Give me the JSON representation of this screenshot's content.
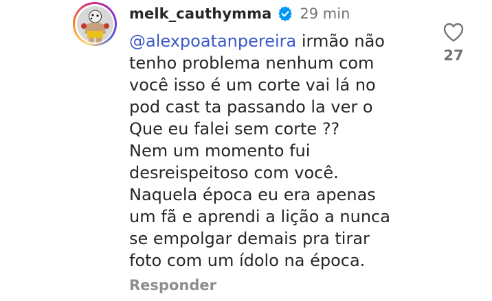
{
  "comment": {
    "username": "melk_cauthymma",
    "verified_icon": "verified-badge-icon",
    "timestamp": "29 min",
    "mention": "@alexpoatanpereira",
    "lines": [
      " irmão não",
      "tenho problema nenhum com",
      "você isso é um corte vai lá no",
      "pod cast ta passando la ver o",
      "Que eu falei sem corte ??",
      "Nem um momento fui",
      "desreispeitoso com você.",
      "Naquela época eu era apenas",
      "um fã e aprendi a lição a nunca",
      "se empolgar demais pra tirar",
      "foto com um ídolo na época."
    ],
    "reply_label": "Responder",
    "like_icon": "heart-outline-icon",
    "like_count": "27"
  },
  "colors": {
    "text": "#262626",
    "muted": "#737373",
    "mention": "#3b59c9",
    "verified": "#0095f6"
  }
}
